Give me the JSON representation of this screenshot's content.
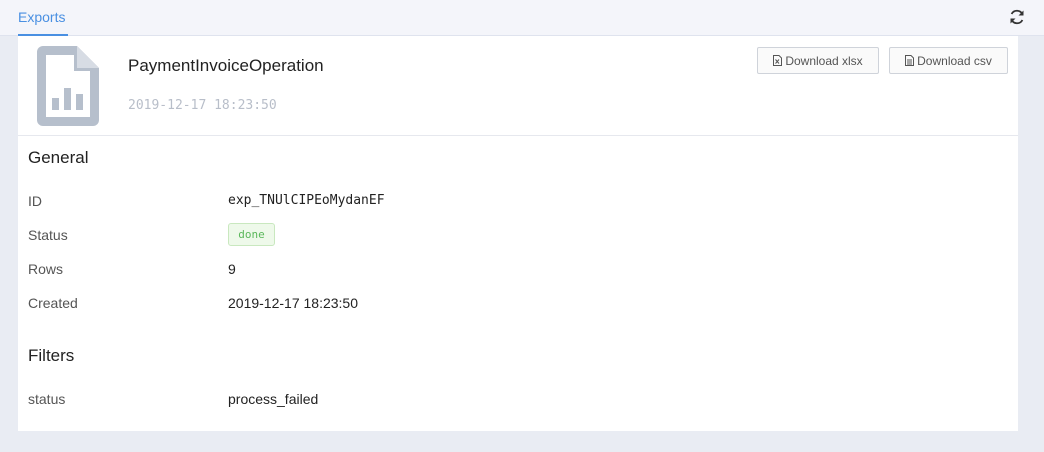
{
  "tabs": [
    {
      "label": "Exports"
    }
  ],
  "refresh_icon": "refresh-icon",
  "export": {
    "icon": "document-chart-icon",
    "title": "PaymentInvoiceOperation",
    "timestamp": "2019-12-17 18:23:50",
    "actions": {
      "xlsx_label": "Download xlsx",
      "csv_label": "Download csv"
    }
  },
  "general": {
    "heading": "General",
    "id_label": "ID",
    "id_value": "exp_TNUlCIPEoMydanEF",
    "status_label": "Status",
    "status_value": "done",
    "rows_label": "Rows",
    "rows_value": "9",
    "created_label": "Created",
    "created_value": "2019-12-17 18:23:50"
  },
  "filters": {
    "heading": "Filters",
    "items": [
      {
        "label": "status",
        "value": "process_failed"
      }
    ]
  },
  "colors": {
    "accent": "#4a90e2",
    "status_done": "#5cb85c",
    "icon_gray": "#b6bfcc"
  }
}
